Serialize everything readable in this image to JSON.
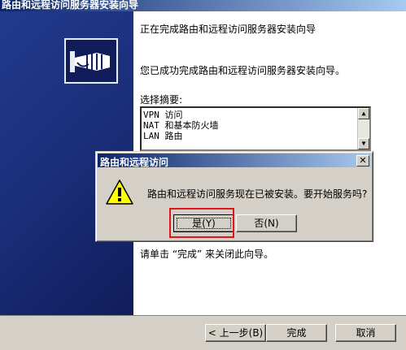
{
  "wizard": {
    "title": "路由和远程访问服务器安装向导",
    "heading": "正在完成路由和远程访问服务器安装向导",
    "description": "您已成功完成路由和远程访问服务器安装向导。",
    "summary_label": "选择摘要:",
    "summary_lines": [
      "VPN 访问",
      "NAT 和基本防火墙",
      "LAN 路由"
    ],
    "close_hint": "请单击 “完成” 来关闭此向导。",
    "buttons": {
      "back": "< 上一步(B)",
      "finish": "完成",
      "cancel": "取消"
    }
  },
  "dialog": {
    "title": "路由和远程访问",
    "close_glyph": "✕",
    "message": "路由和远程访问服务现在已被安装。要开始服务吗?",
    "yes_label": "是(Y)",
    "no_label": "否(N)",
    "icon": "warning-icon"
  },
  "colors": {
    "banner": "#1b2f7c",
    "titlebar": "#0a246a",
    "highlight": "#e3141c"
  }
}
